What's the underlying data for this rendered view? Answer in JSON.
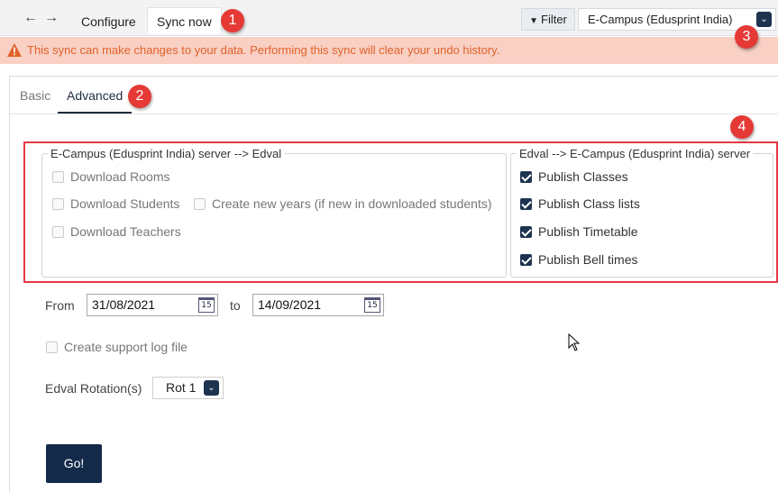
{
  "toolbar": {
    "back": "←",
    "forward": "→",
    "tabs": [
      "Configure",
      "Sync now"
    ],
    "filter_label": "Filter",
    "connection_selected": "E-Campus (Edusprint India)"
  },
  "warning": "This sync can make changes to your data. Performing this sync will clear your undo history.",
  "subtabs": [
    "Basic",
    "Advanced"
  ],
  "callouts": [
    "1",
    "2",
    "3",
    "4"
  ],
  "download_group": {
    "legend": "E-Campus (Edusprint India) server --> Edval",
    "items": [
      {
        "label": "Download Rooms",
        "checked": false
      },
      {
        "label": "Download Students",
        "checked": false
      },
      {
        "label": "Create new years (if new in downloaded students)",
        "checked": false
      },
      {
        "label": "Download Teachers",
        "checked": false
      }
    ]
  },
  "publish_group": {
    "legend": "Edval --> E-Campus (Edusprint India) server",
    "items": [
      {
        "label": "Publish Classes",
        "checked": true
      },
      {
        "label": "Publish Class lists",
        "checked": true
      },
      {
        "label": "Publish Timetable",
        "checked": true
      },
      {
        "label": "Publish Bell times",
        "checked": true
      }
    ]
  },
  "dates": {
    "from_label": "From",
    "from_value": "31/08/2021",
    "to_label": "to",
    "to_value": "14/09/2021",
    "calendar_day": "15"
  },
  "support_log": {
    "label": "Create support log file",
    "checked": false
  },
  "rotation": {
    "label": "Edval Rotation(s)",
    "selected": "Rot 1"
  },
  "go_button": "Go!",
  "colors": {
    "navy": "#1e3350",
    "warning_bg": "#f9d0c4",
    "warning_text": "#e0622a",
    "callout_red": "#e53935"
  }
}
